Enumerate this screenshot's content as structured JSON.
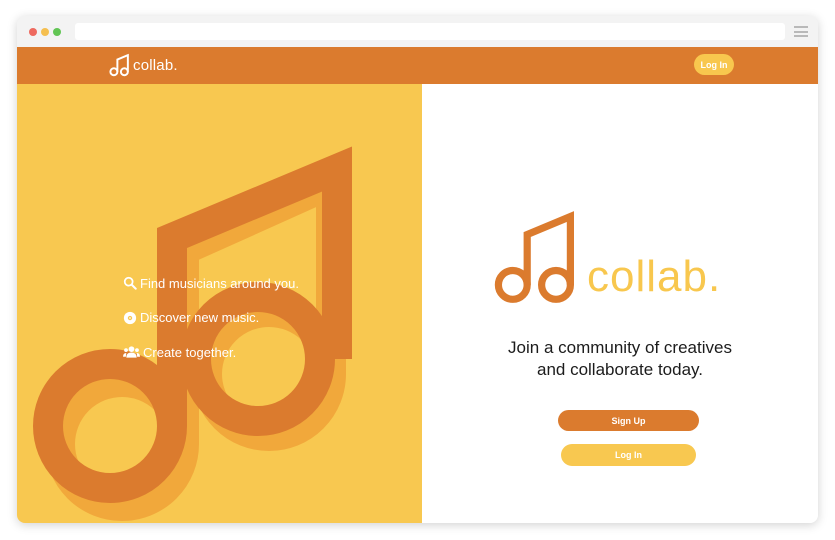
{
  "brand": {
    "name": "collab.",
    "primary_color": "#db7b2e",
    "accent_color": "#f8c850"
  },
  "nav": {
    "login_label": "Log In"
  },
  "features": [
    {
      "icon": "search-icon",
      "label": "Find musicians around you."
    },
    {
      "icon": "disc-icon",
      "label": "Discover new music."
    },
    {
      "icon": "users-icon",
      "label": "Create together."
    }
  ],
  "hero": {
    "logo_text": "collab.",
    "tagline_line1": "Join a community of creatives",
    "tagline_line2": "and collaborate today.",
    "signup_label": "Sign Up",
    "login_label": "Log In"
  }
}
